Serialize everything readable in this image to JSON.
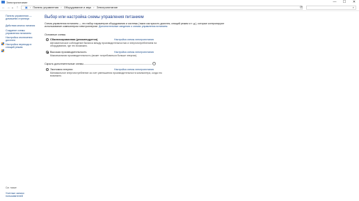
{
  "window": {
    "title": "Электропитание",
    "minimize": "—",
    "maximize": "☐",
    "close": "✕"
  },
  "addressbar": {
    "back": "←",
    "forward": "→",
    "dropdown": "⌄",
    "up": "↑",
    "root_icon": "▣",
    "breadcrumbs": [
      "Панель управления",
      "Оборудование и звук",
      "Электропитание"
    ],
    "separator": "›",
    "refresh": "⟳",
    "search_glyph": "⌕"
  },
  "sidebar": {
    "links": [
      "Панель управления — домашняя страница",
      "Действия кнопок питания",
      "Создание схемы управления питанием",
      "Настройка отключения дисплея",
      "Настройка перехода в спящий режим"
    ],
    "see_also": "См. также",
    "bottom_links": [
      "Учетные записи пользователей"
    ]
  },
  "main": {
    "title": "Выбор или настройка схемы управления питанием",
    "intro": "Схема управления питанием — это набор параметров оборудования и системы (таких как яркость дисплея, спящий режим и т. д.), которые контролируют использование компьютером электроэнергии.",
    "intro_link": "Дополнительные сведения о схемах управления питанием",
    "section_main": "Основные схемы",
    "section_additional": "Скрыть дополнительные схемы",
    "expand_glyph": "⌃",
    "plans": [
      {
        "name": "Сбалансированная (рекомендуется)",
        "desc": "Автоматическое соблюдение баланса между производительностью и энергопотреблением на оборудовании, где это возможно.",
        "link": "Настройка схемы электропитания",
        "checked": false
      },
      {
        "name": "Высокая производительность",
        "desc": "Максимальная производительность (может потребоваться больше энергии).",
        "link": "Настройка схемы электропитания",
        "checked": true
      },
      {
        "name": "Экономия энергии",
        "desc": "Минимальное энергопотребление за счет уменьшения производительности компьютера, когда это возможно.",
        "link": "Настройка схемы электропитания",
        "checked": false
      }
    ]
  },
  "colors": {
    "link": "#1a4c8a",
    "title": "#1e3f8f"
  }
}
